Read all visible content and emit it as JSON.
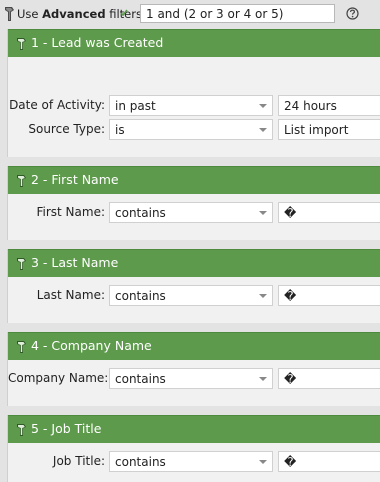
{
  "toolbar": {
    "use_label": "Use",
    "advanced_label": "Advanced",
    "filters_label": "filters",
    "filter_logic": "1 and (2 or 3 or 4 or 5)",
    "help_icon": "question-circle-icon",
    "settings_icon": "wrench-icon"
  },
  "colors": {
    "header_green": "#5d9a4c",
    "background": "#e3e3e3",
    "card_body": "#f1f1f1"
  },
  "filters": [
    {
      "title": "1 - Lead was Created",
      "rows": [
        {
          "label": "Date of Activity:",
          "operator": "in past",
          "value": "24 hours"
        },
        {
          "label": "Source Type:",
          "operator": "is",
          "value": "List import"
        }
      ]
    },
    {
      "title": "2 - First Name",
      "rows": [
        {
          "label": "First Name:",
          "operator": "contains",
          "value": "�"
        }
      ]
    },
    {
      "title": "3 - Last Name",
      "rows": [
        {
          "label": "Last Name:",
          "operator": "contains",
          "value": "�"
        }
      ]
    },
    {
      "title": "4 - Company Name",
      "rows": [
        {
          "label": "Company Name:",
          "operator": "contains",
          "value": "�"
        }
      ]
    },
    {
      "title": "5 - Job Title",
      "rows": [
        {
          "label": "Job Title:",
          "operator": "contains",
          "value": "�"
        }
      ]
    }
  ]
}
